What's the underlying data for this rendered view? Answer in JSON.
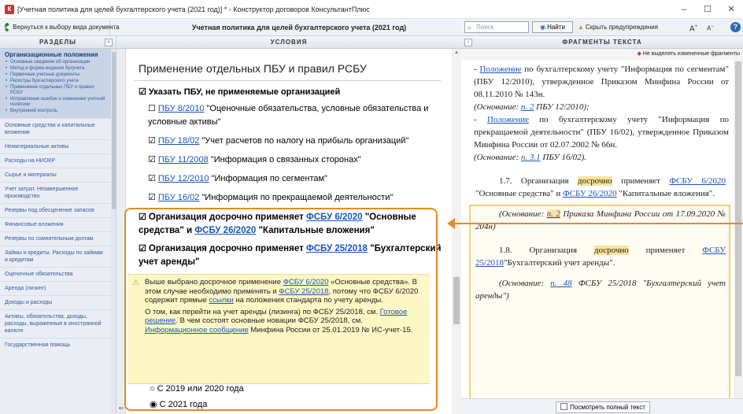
{
  "window": {
    "title": "[Учетная политика для целей бухгалтерского учета (2021 год)] * - Конструктор договоров КонсультантПлюс",
    "minimize": "–",
    "maximize": "☐",
    "close": "✕"
  },
  "toolbar": {
    "back_label": "Вернуться к выбору вида документа",
    "doc_title": "Учетная политика для целей бухгалтерского учета (2021 год)",
    "search_placeholder": "Поиск",
    "find_label": "Найти",
    "hide_warnings_label": "Скрыть предупреждения",
    "font_larger": "A",
    "font_smaller": "A",
    "help": "?"
  },
  "left_panel": {
    "header": "РАЗДЕЛЫ",
    "collapse": "«",
    "active_section": "Организационные положения",
    "active_items": [
      "Основные сведения об организации",
      "Метод и форма ведения бухучета",
      "Первичные учетные документы",
      "Регистры бухгалтерского учета",
      "Применение отдельных ПБУ и правил РСБУ",
      "Исправление ошибок и изменение учетной политики",
      "Внутренний контроль"
    ],
    "sections": [
      "Основные средства и капитальные вложения",
      "Нематериальные активы",
      "Расходы на НИОКР",
      "Сырье и материалы",
      "Учет затрат. Незавершенное производство",
      "Резервы под обесценение запасов",
      "Финансовые вложения",
      "Резервы по сомнительным долгам",
      "Займы и кредиты. Расходы по займам и кредитам",
      "Оценочные обязательства",
      "Аренда (лизинг)",
      "Доходы и расходы",
      "Активы, обязательства, доходы, расходы, выраженные в иностранной валюте",
      "Государственная помощь"
    ]
  },
  "middle_panel": {
    "header": "УСЛОВИЯ",
    "section_title": "Применение отдельных ПБУ и правил РСБУ",
    "main_option": "Указать ПБУ, не применяемые организацией",
    "pbu_items": [
      {
        "checked": false,
        "link": "ПБУ 8/2010",
        "text": "\"Оценочные обязательства, условные обязательства и условные активы\""
      },
      {
        "checked": true,
        "link": "ПБУ 18/02",
        "text": "\"Учет расчетов по налогу на прибыль организаций\""
      },
      {
        "checked": true,
        "link": "ПБУ 11/2008",
        "text": "\"Информация о связанных сторонах\""
      },
      {
        "checked": true,
        "link": "ПБУ 12/2010",
        "text": "\"Информация по сегментам\""
      },
      {
        "checked": true,
        "link": "ПБУ 16/02",
        "text": "\"Информация по прекращаемой деятельности\""
      }
    ],
    "early_fsbu6": {
      "prefix": "Организация досрочно применяет",
      "link1": "ФСБУ 6/2020",
      "mid": "\"Основные средства\" и",
      "link2": "ФСБУ 26/2020",
      "suffix": "\"Капитальные вложения\""
    },
    "early_fsbu25": {
      "prefix": "Организация досрочно применяет",
      "link": "ФСБУ 25/2018",
      "suffix": "\"Бухгалтерский учет аренды\""
    },
    "warning": {
      "p1_a": "Выше выбрано досрочное применение",
      "p1_link1": "ФСБУ 6/2020",
      "p1_b": "«Основные средства». В этом случае необходимо применять и",
      "p1_link2": "ФСБУ 25/2018",
      "p1_c": ", потому что ФСБУ 6/2020 содержит прямые",
      "p1_link3": "ссылки",
      "p1_d": "на положения стандарта по учету аренды.",
      "p2_a": "О том, как перейти на учет аренды (лизинга) по ФСБУ 25/2018, см.",
      "p2_link1": "Готовое решение",
      "p2_b": ". В чем состоят основные новации ФСБУ 25/2018, см.",
      "p2_link2": "Информационное сообщение",
      "p2_c": "Минфина России от 25.01.2019 № ИС-учет-15."
    },
    "radio1": "С 2019 или 2020 года",
    "radio2": "С 2021 года"
  },
  "right_panel": {
    "header": "ФРАГМЕНТЫ ТЕКСТА",
    "note": "Не выделять измененные фрагменты",
    "p1_link": "Положение",
    "p1_text": "по бухгалтерскому учету \"Информация по сегментам\" (ПБУ 12/2010), утвержденное Приказом Минфина России от 08.11.2010 № 143н.",
    "p1_basis_a": "(Основание:",
    "p1_basis_link": "п. 2",
    "p1_basis_b": "ПБУ 12/2010);",
    "p2_link": "Положение",
    "p2_text": "по бухгалтерскому учету \"Информация по прекращаемой деятельности\" (ПБУ 16/02), утвержденное Приказом Минфина России от 02.07.2002 № 66н.",
    "p2_basis_a": "(Основание:",
    "p2_basis_link": "п. 3.1",
    "p2_basis_b": "ПБУ 16/02).",
    "f17_num": "1.7.",
    "f17_a": "Организация",
    "f17_mark": "досрочно",
    "f17_b": "применяет",
    "f17_link1": "ФСБУ 6/2020",
    "f17_c": "\"Основные средства\" и",
    "f17_link2": "ФСБУ 26/2020",
    "f17_d": "\"Капитальные вложения\".",
    "f17_basis_a": "(Основание:",
    "f17_basis_link": "п. 2",
    "f17_basis_b": "Приказа Минфина России от 17.09.2020 № 204н)",
    "f18_num": "1.8.",
    "f18_a": "Организация",
    "f18_mark": "досрочно",
    "f18_b": "применяет",
    "f18_link": "ФСБУ 25/2018",
    "f18_c": "\"Бухгалтерский учет аренды\".",
    "f18_basis_a": "(Основание:",
    "f18_basis_link": "п. 48",
    "f18_basis_b": "ФСБУ 25/2018 \"Бухгалтерский учет аренды\")",
    "view_full": "Посмотреть полный текст"
  }
}
